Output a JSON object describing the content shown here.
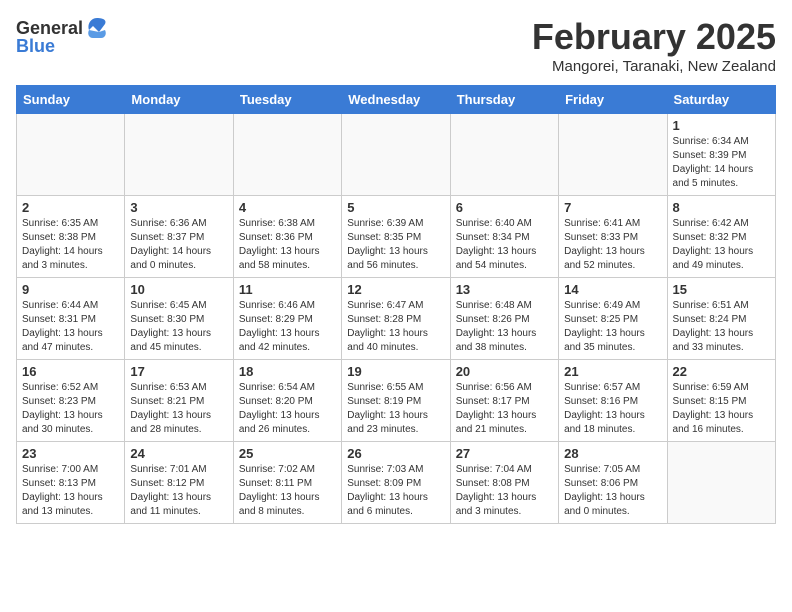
{
  "header": {
    "logo_general": "General",
    "logo_blue": "Blue",
    "title": "February 2025",
    "subtitle": "Mangorei, Taranaki, New Zealand"
  },
  "weekdays": [
    "Sunday",
    "Monday",
    "Tuesday",
    "Wednesday",
    "Thursday",
    "Friday",
    "Saturday"
  ],
  "weeks": [
    [
      {
        "day": "",
        "info": ""
      },
      {
        "day": "",
        "info": ""
      },
      {
        "day": "",
        "info": ""
      },
      {
        "day": "",
        "info": ""
      },
      {
        "day": "",
        "info": ""
      },
      {
        "day": "",
        "info": ""
      },
      {
        "day": "1",
        "info": "Sunrise: 6:34 AM\nSunset: 8:39 PM\nDaylight: 14 hours and 5 minutes."
      }
    ],
    [
      {
        "day": "2",
        "info": "Sunrise: 6:35 AM\nSunset: 8:38 PM\nDaylight: 14 hours and 3 minutes."
      },
      {
        "day": "3",
        "info": "Sunrise: 6:36 AM\nSunset: 8:37 PM\nDaylight: 14 hours and 0 minutes."
      },
      {
        "day": "4",
        "info": "Sunrise: 6:38 AM\nSunset: 8:36 PM\nDaylight: 13 hours and 58 minutes."
      },
      {
        "day": "5",
        "info": "Sunrise: 6:39 AM\nSunset: 8:35 PM\nDaylight: 13 hours and 56 minutes."
      },
      {
        "day": "6",
        "info": "Sunrise: 6:40 AM\nSunset: 8:34 PM\nDaylight: 13 hours and 54 minutes."
      },
      {
        "day": "7",
        "info": "Sunrise: 6:41 AM\nSunset: 8:33 PM\nDaylight: 13 hours and 52 minutes."
      },
      {
        "day": "8",
        "info": "Sunrise: 6:42 AM\nSunset: 8:32 PM\nDaylight: 13 hours and 49 minutes."
      }
    ],
    [
      {
        "day": "9",
        "info": "Sunrise: 6:44 AM\nSunset: 8:31 PM\nDaylight: 13 hours and 47 minutes."
      },
      {
        "day": "10",
        "info": "Sunrise: 6:45 AM\nSunset: 8:30 PM\nDaylight: 13 hours and 45 minutes."
      },
      {
        "day": "11",
        "info": "Sunrise: 6:46 AM\nSunset: 8:29 PM\nDaylight: 13 hours and 42 minutes."
      },
      {
        "day": "12",
        "info": "Sunrise: 6:47 AM\nSunset: 8:28 PM\nDaylight: 13 hours and 40 minutes."
      },
      {
        "day": "13",
        "info": "Sunrise: 6:48 AM\nSunset: 8:26 PM\nDaylight: 13 hours and 38 minutes."
      },
      {
        "day": "14",
        "info": "Sunrise: 6:49 AM\nSunset: 8:25 PM\nDaylight: 13 hours and 35 minutes."
      },
      {
        "day": "15",
        "info": "Sunrise: 6:51 AM\nSunset: 8:24 PM\nDaylight: 13 hours and 33 minutes."
      }
    ],
    [
      {
        "day": "16",
        "info": "Sunrise: 6:52 AM\nSunset: 8:23 PM\nDaylight: 13 hours and 30 minutes."
      },
      {
        "day": "17",
        "info": "Sunrise: 6:53 AM\nSunset: 8:21 PM\nDaylight: 13 hours and 28 minutes."
      },
      {
        "day": "18",
        "info": "Sunrise: 6:54 AM\nSunset: 8:20 PM\nDaylight: 13 hours and 26 minutes."
      },
      {
        "day": "19",
        "info": "Sunrise: 6:55 AM\nSunset: 8:19 PM\nDaylight: 13 hours and 23 minutes."
      },
      {
        "day": "20",
        "info": "Sunrise: 6:56 AM\nSunset: 8:17 PM\nDaylight: 13 hours and 21 minutes."
      },
      {
        "day": "21",
        "info": "Sunrise: 6:57 AM\nSunset: 8:16 PM\nDaylight: 13 hours and 18 minutes."
      },
      {
        "day": "22",
        "info": "Sunrise: 6:59 AM\nSunset: 8:15 PM\nDaylight: 13 hours and 16 minutes."
      }
    ],
    [
      {
        "day": "23",
        "info": "Sunrise: 7:00 AM\nSunset: 8:13 PM\nDaylight: 13 hours and 13 minutes."
      },
      {
        "day": "24",
        "info": "Sunrise: 7:01 AM\nSunset: 8:12 PM\nDaylight: 13 hours and 11 minutes."
      },
      {
        "day": "25",
        "info": "Sunrise: 7:02 AM\nSunset: 8:11 PM\nDaylight: 13 hours and 8 minutes."
      },
      {
        "day": "26",
        "info": "Sunrise: 7:03 AM\nSunset: 8:09 PM\nDaylight: 13 hours and 6 minutes."
      },
      {
        "day": "27",
        "info": "Sunrise: 7:04 AM\nSunset: 8:08 PM\nDaylight: 13 hours and 3 minutes."
      },
      {
        "day": "28",
        "info": "Sunrise: 7:05 AM\nSunset: 8:06 PM\nDaylight: 13 hours and 0 minutes."
      },
      {
        "day": "",
        "info": ""
      }
    ]
  ]
}
